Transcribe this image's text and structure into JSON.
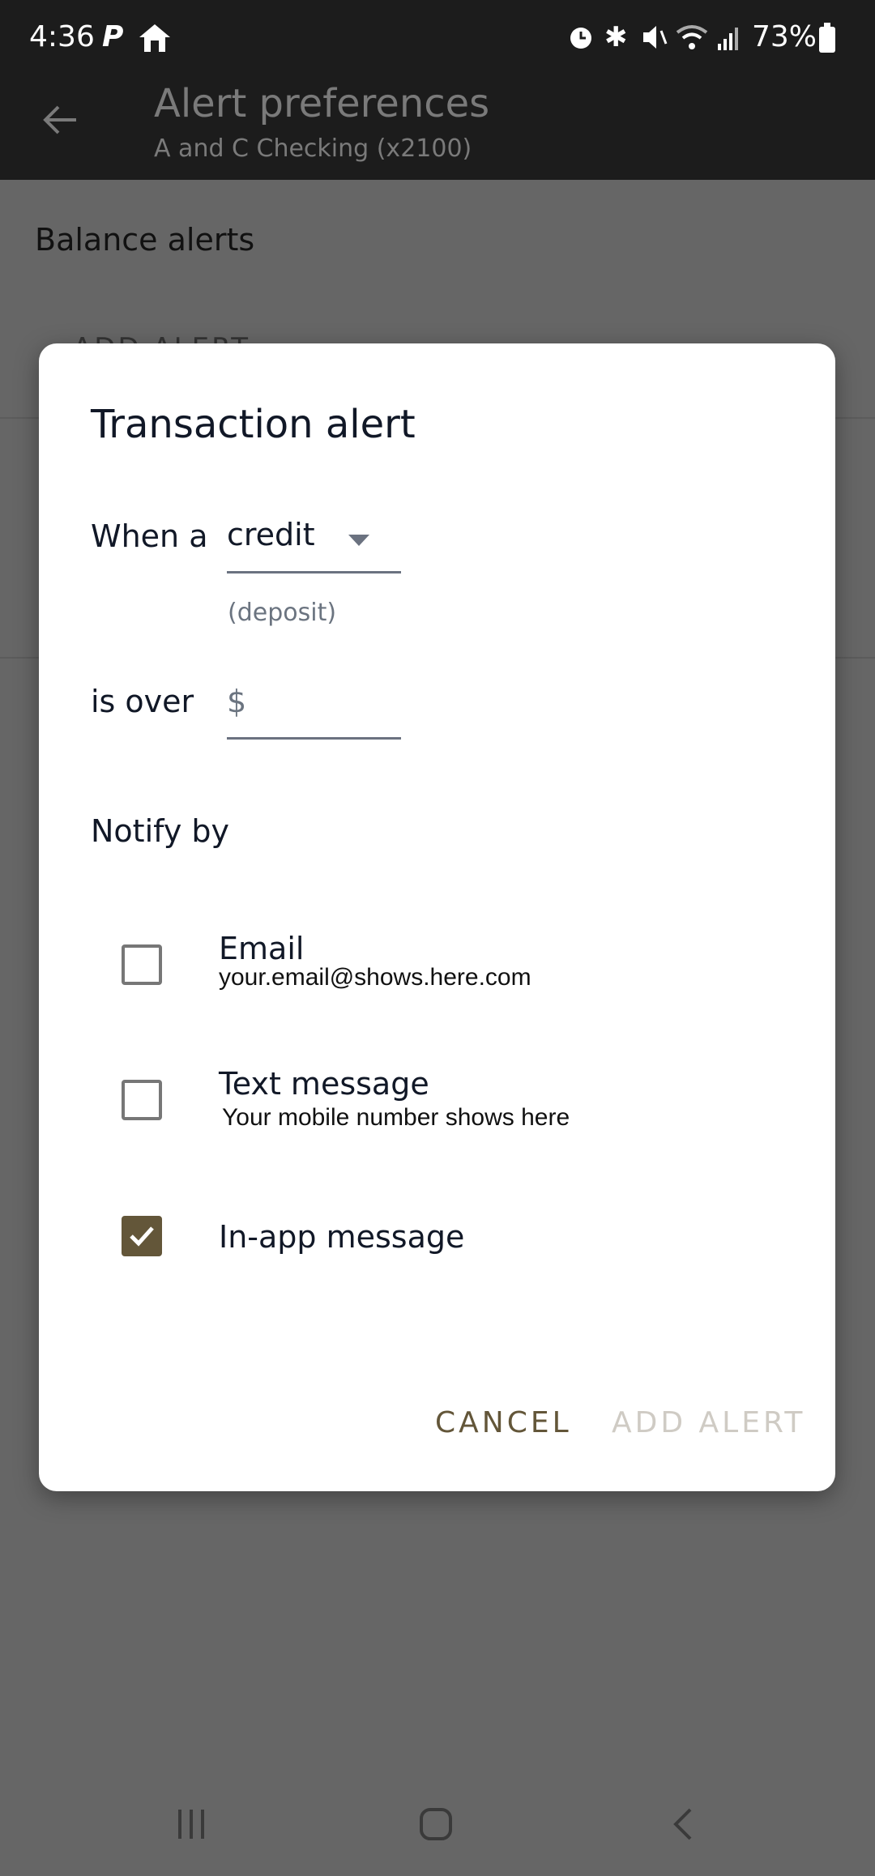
{
  "status_bar": {
    "time": "4:36",
    "battery": "73%",
    "left_icons": [
      "p-app-icon",
      "home-icon"
    ],
    "right_icons": [
      "alarm-icon",
      "bluetooth-icon",
      "mute-icon",
      "wifi-icon",
      "signal-icon",
      "battery-icon"
    ]
  },
  "app_bar": {
    "title": "Alert preferences",
    "subtitle": "A and C Checking (x2100)"
  },
  "background": {
    "section_title": "Balance alerts",
    "add_alert_label": "ADD ALERT"
  },
  "dialog": {
    "title": "Transaction alert",
    "when_label": "When a",
    "type_select": {
      "value": "credit",
      "helper": "(deposit)"
    },
    "over_label": "is over",
    "amount": {
      "prefix": "$",
      "value": ""
    },
    "notify_label": "Notify by",
    "options": [
      {
        "label": "Email",
        "detail": "your.email@shows.here.com",
        "checked": false
      },
      {
        "label": "Text message",
        "detail": "Your mobile number shows here",
        "checked": false
      },
      {
        "label": "In-app message",
        "checked": true
      }
    ],
    "cancel_label": "CANCEL",
    "add_label": "ADD ALERT"
  },
  "colors": {
    "accent": "#635639",
    "disabled": "#cfcbc4",
    "overlay": "#666666",
    "appbar": "#1c1c1c"
  }
}
